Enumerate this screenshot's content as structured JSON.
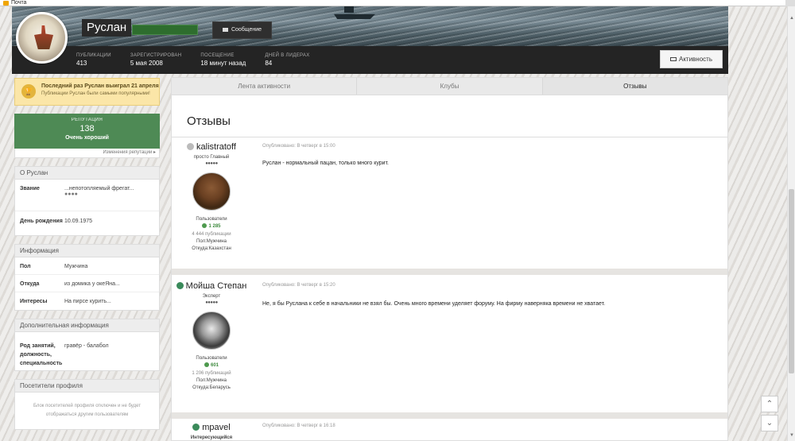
{
  "window": {
    "title": "Почта"
  },
  "profile": {
    "name": "Руслан",
    "message_button": "Сообщение",
    "activity_button": "Активность",
    "stats": [
      {
        "label": "ПУБЛИКАЦИИ",
        "value": "413"
      },
      {
        "label": "ЗАРЕГИСТРИРОВАН",
        "value": "5 мая 2008"
      },
      {
        "label": "ПОСЕЩЕНИЕ",
        "value": "18 минут назад"
      },
      {
        "label": "ДНЕЙ В ЛИДЕРАХ",
        "value": "84"
      }
    ]
  },
  "leader_banner": {
    "title": "Последний раз Руслан выиграл 21 апреля",
    "subtitle": "Публикации Руслан были самыми популярными!"
  },
  "reputation": {
    "label": "РЕПУТАЦИЯ",
    "value": "138",
    "level": "Очень хороший",
    "link": "Изменения репутации ▸"
  },
  "about": {
    "title": "О Руслан",
    "rows": [
      {
        "key": "Звание",
        "value": "...непотопляемый фрегат...",
        "pips": "●●●●"
      },
      {
        "key": "День рождения",
        "value": "10.09.1975"
      }
    ]
  },
  "info": {
    "title": "Информация",
    "rows": [
      {
        "key": "Пол",
        "value": "Мужчина"
      },
      {
        "key": "Откуда",
        "value": "из домика у океЯна..."
      },
      {
        "key": "Интересы",
        "value": "На пирсе курить..."
      }
    ]
  },
  "extra": {
    "title": "Дополнительная информация",
    "rows": [
      {
        "key": "Род занятий, должность, специальность",
        "value": "гравёр - балабол"
      }
    ]
  },
  "visitors": {
    "title": "Посетители профиля",
    "text": "Блок посетителей профиля отключен и не будет отображаться другим пользователям"
  },
  "tabs": [
    {
      "label": "Лента активности"
    },
    {
      "label": "Клубы"
    },
    {
      "label": "Отзывы"
    }
  ],
  "page_title": "Отзывы",
  "posts": [
    {
      "author": "kalistratoff",
      "status": "offline",
      "group": "просто Главный",
      "pips": "●●●●●",
      "role": "Пользователи",
      "score": "1 285",
      "publications": "4 444 публикации",
      "gender": "Пол:Мужчина",
      "from": "Откуда:Казахстан",
      "date": "Опубликовано: В четверг в 15:00",
      "text": "Руслан - нормальный пацан, только много курит."
    },
    {
      "author": "Мойша Степан",
      "status": "online",
      "group": "Эксперт",
      "pips": "●●●●●",
      "role": "Пользователи",
      "score": "601",
      "publications": "1 206 публикаций",
      "gender": "Пол:Мужчина",
      "from": "Откуда:Беларусь",
      "date": "Опубликовано: В четверг в 15:20",
      "text": "Не, я бы Руслана к себе в начальники не взял бы. Очень много времени уделяет форуму. На фирму наверняка времени не хватает."
    },
    {
      "author": "mpavel",
      "status": "online",
      "group": "Интересующийся",
      "date": "Опубликовано: В четверг в 16:18"
    }
  ],
  "colors": {
    "accent_green": "#4e8a55",
    "online": "#3a8a5a",
    "offline": "#bbbbbb",
    "banner_yellow": "#fbe6a8"
  }
}
